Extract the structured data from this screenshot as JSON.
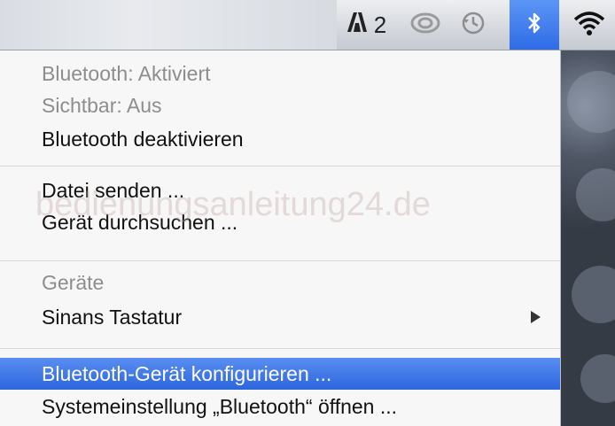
{
  "menubar": {
    "adobe_badge": "2",
    "icons": [
      "adobe-icon",
      "creative-cloud-icon",
      "time-machine-icon",
      "bluetooth-icon",
      "wifi-icon"
    ],
    "bluetooth_accent": "#3574ea"
  },
  "menu": {
    "status_label": "Bluetooth: Aktiviert",
    "visible_label": "Sichtbar: Aus",
    "disable_label": "Bluetooth deaktivieren",
    "send_file_label": "Datei senden ...",
    "browse_device_label": "Gerät durchsuchen ...",
    "devices_header": "Geräte",
    "device_label": "Sinans Tastatur",
    "setup_device_label": "Bluetooth-Gerät konfigurieren ...",
    "open_prefs_label": "Systemeinstellung „Bluetooth“ öffnen ...",
    "highlight_color": "#3a73e6"
  },
  "watermark": "bedienungsanleitung24.de"
}
